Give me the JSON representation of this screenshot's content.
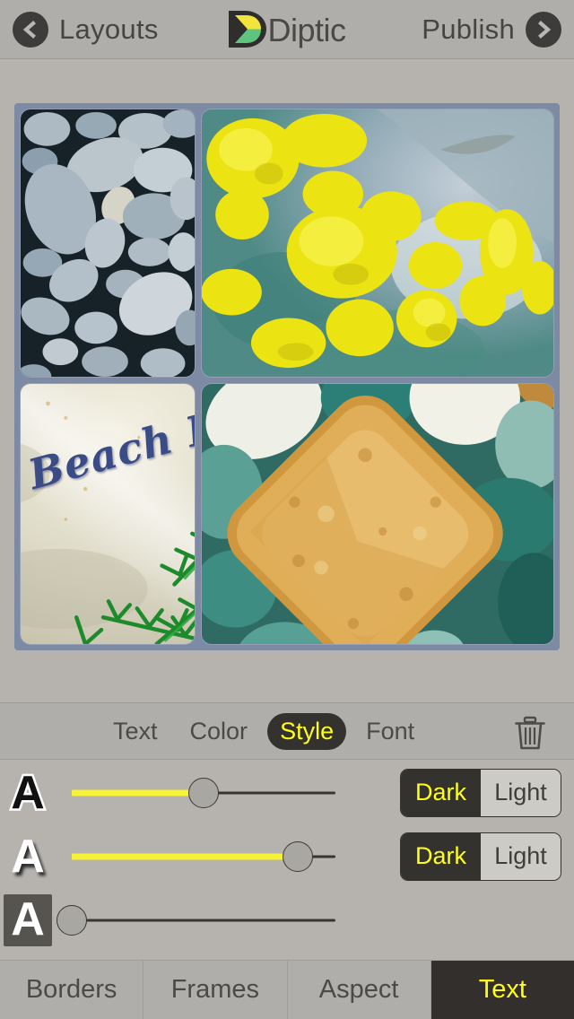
{
  "app": {
    "name": "Diptic",
    "logo_icon": "diptic-logo-icon",
    "logo_colors": {
      "dark": "#2f2e2c",
      "yellow": "#f2e43a",
      "green": "#5ec47e"
    }
  },
  "navbar": {
    "back_icon": "chevron-left-circle-icon",
    "back_label": "Layouts",
    "forward_icon": "chevron-right-circle-icon",
    "forward_label": "Publish",
    "title": "Diptic"
  },
  "collage": {
    "frame_color": "#7d8aa3",
    "layout": "2x2-grid",
    "cells": [
      {
        "name": "photo-top-left",
        "caption": "gray beach pebbles"
      },
      {
        "name": "photo-top-right",
        "caption": "yellow lichen on rock"
      },
      {
        "name": "photo-bottom-left",
        "caption": "stone sign with foliage",
        "overlay_text": "Beach Pebbles",
        "text_color": "#3b4b86"
      },
      {
        "name": "photo-bottom-right",
        "caption": "tan diamond stone on teal pebbles"
      }
    ]
  },
  "subtoolbar": {
    "items": [
      {
        "label": "Text",
        "active": false
      },
      {
        "label": "Color",
        "active": false
      },
      {
        "label": "Style",
        "active": true
      },
      {
        "label": "Font",
        "active": false
      }
    ],
    "trash_icon": "trash-icon",
    "active_color": "#ffff19"
  },
  "style_rows": [
    {
      "glyph": "A",
      "style_name": "outline",
      "slider": {
        "value": 50,
        "min": 0,
        "max": 100,
        "fill_color": "#f7f234"
      },
      "segmented": {
        "options": [
          "Dark",
          "Light"
        ],
        "selected": "Dark"
      }
    },
    {
      "glyph": "A",
      "style_name": "shadow",
      "slider": {
        "value": 86,
        "min": 0,
        "max": 100,
        "fill_color": "#f7f234"
      },
      "segmented": {
        "options": [
          "Dark",
          "Light"
        ],
        "selected": "Dark"
      }
    },
    {
      "glyph": "A",
      "style_name": "background",
      "slider": {
        "value": 0,
        "min": 0,
        "max": 100,
        "fill_color": "#f7f234"
      },
      "segmented": null
    }
  ],
  "tabbar": {
    "tabs": [
      {
        "label": "Borders",
        "active": false
      },
      {
        "label": "Frames",
        "active": false
      },
      {
        "label": "Aspect",
        "active": false
      },
      {
        "label": "Text",
        "active": true
      }
    ],
    "active_color": "#ffff19"
  }
}
